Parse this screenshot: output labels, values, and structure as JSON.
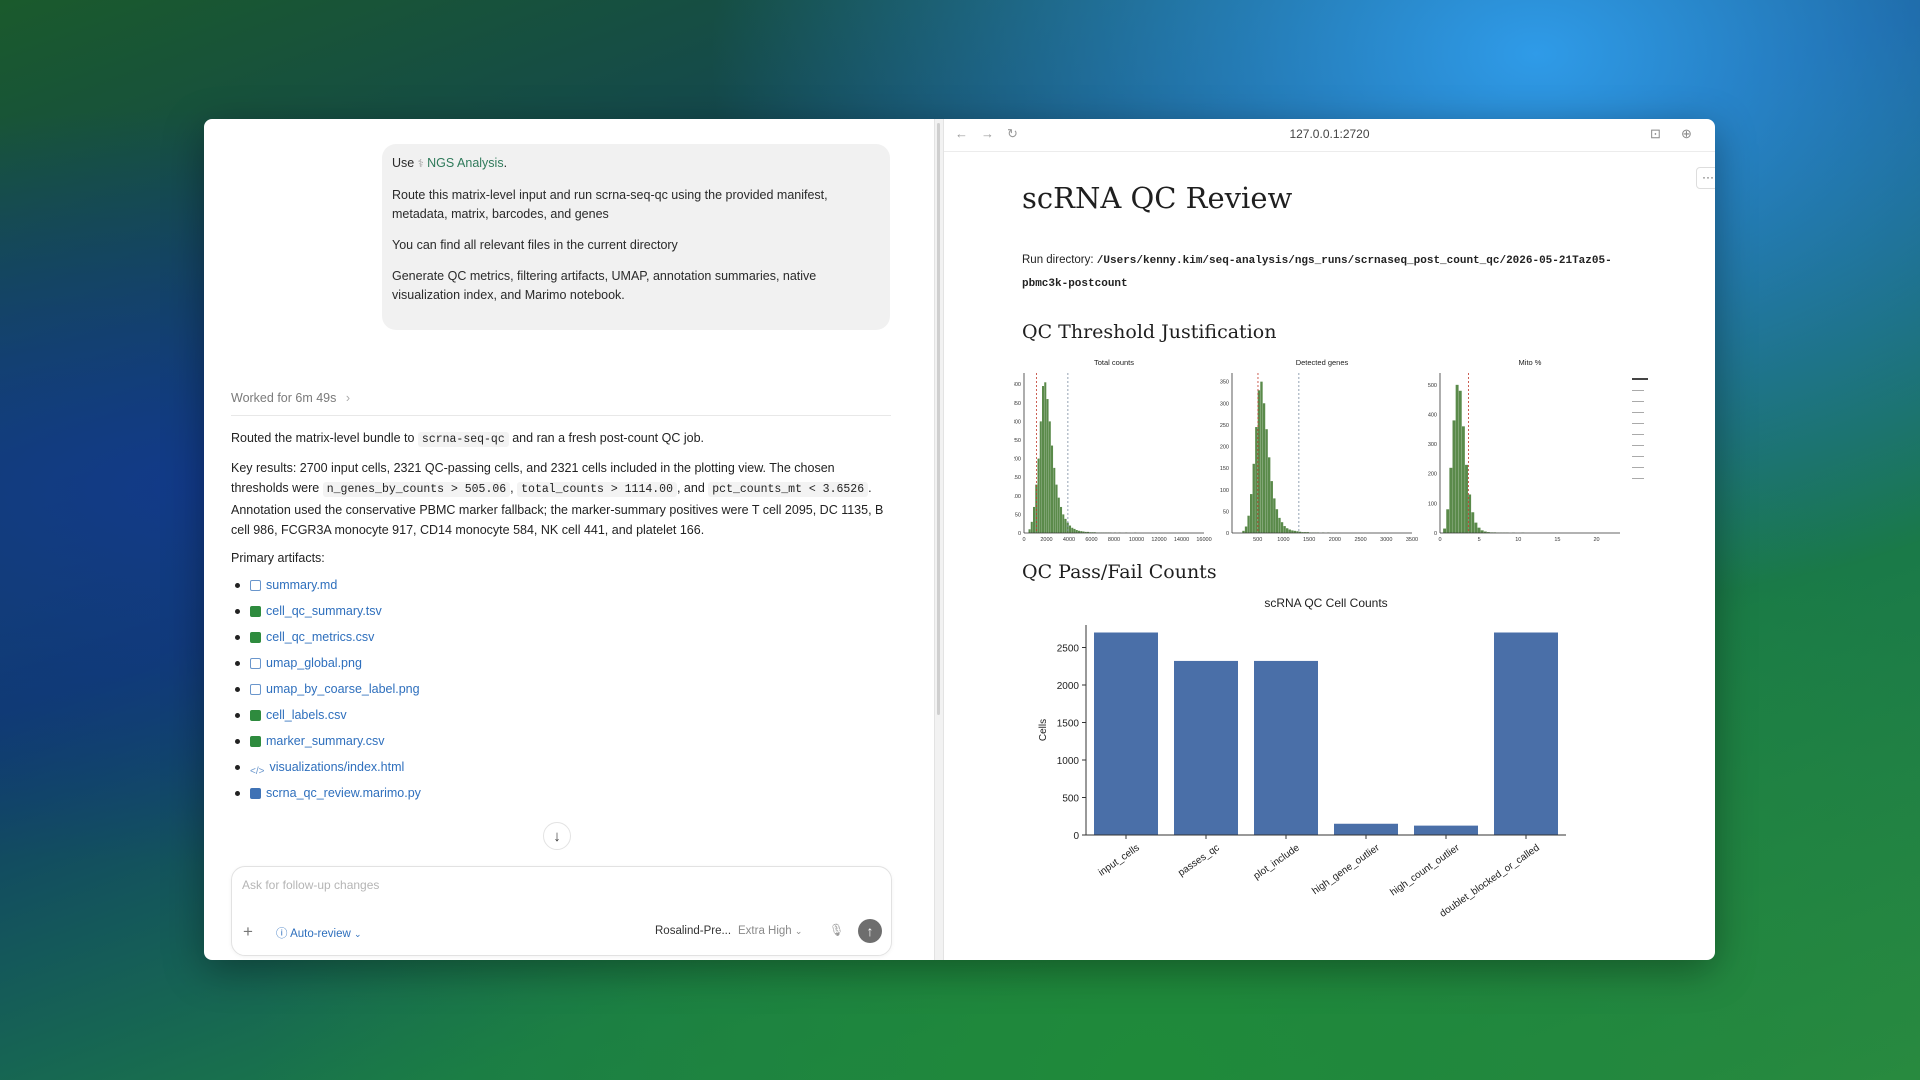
{
  "chat": {
    "user_message": {
      "use_prefix": "Use",
      "skill_name": "NGS Analysis",
      "skill_suffix": ".",
      "line1": "Route this matrix-level input and run scrna-seq-qc using the provided manifest, metadata, matrix, barcodes, and genes",
      "line2": "You can find all relevant files in the current directory",
      "line3": "Generate QC metrics, filtering artifacts, UMAP, annotation summaries, native visualization index, and Marimo notebook."
    },
    "worked_for": "Worked for 6m 49s",
    "answer": {
      "p1_a": "Routed the matrix-level bundle to",
      "p1_code": "scrna-seq-qc",
      "p1_b": "and ran a fresh post-count QC job.",
      "p2_a": "Key results: 2700 input cells, 2321 QC-passing cells, and 2321 cells included in the plotting view. The chosen thresholds were",
      "p2_code1": "n_genes_by_counts > 505.06",
      "p2_sep1": ",",
      "p2_code2": "total_counts > 1114.00",
      "p2_sep2": ", and",
      "p2_code3": "pct_counts_mt < 3.6526",
      "p2_b": ". Annotation used the conservative PBMC marker fallback; the marker-summary positives were T cell 2095, DC 1135, B cell 986, FCGR3A monocyte 917, CD14 monocyte 584, NK cell 441, and platelet 166.",
      "primary_label": "Primary artifacts:",
      "artifacts": [
        {
          "name": "summary.md",
          "icon": "markdown-file-icon"
        },
        {
          "name": "cell_qc_summary.tsv",
          "icon": "spreadsheet-file-icon"
        },
        {
          "name": "cell_qc_metrics.csv",
          "icon": "spreadsheet-file-icon"
        },
        {
          "name": "umap_global.png",
          "icon": "image-file-icon"
        },
        {
          "name": "umap_by_coarse_label.png",
          "icon": "image-file-icon"
        },
        {
          "name": "cell_labels.csv",
          "icon": "spreadsheet-file-icon"
        },
        {
          "name": "marker_summary.csv",
          "icon": "spreadsheet-file-icon"
        },
        {
          "name": "visualizations/index.html",
          "icon": "code-file-icon"
        },
        {
          "name": "scrna_qc_review.marimo.py",
          "icon": "python-file-icon"
        }
      ]
    },
    "composer": {
      "placeholder": "Ask for follow-up changes",
      "auto_review": "Auto-review",
      "model": "Rosalind-Pre...",
      "effort": "Extra High"
    }
  },
  "browser": {
    "url": "127.0.0.1:2720",
    "page": {
      "title": "scRNA QC Review",
      "run_dir_label": "Run directory:",
      "run_dir_path": "/Users/kenny.kim/seq-analysis/ngs_runs/scrnaseq_post_count_qc/2026-05-21Taz05-pbmc3k-postcount",
      "section1": "QC Threshold Justification",
      "section2": "QC Pass/Fail Counts"
    }
  },
  "chart_data": [
    {
      "type": "bar",
      "title": "Total counts",
      "xlabel": "",
      "ylabel": "",
      "xlim": [
        0,
        16000
      ],
      "x_ticks": [
        0,
        2000,
        4000,
        6000,
        8000,
        10000,
        12000,
        14000,
        16000
      ],
      "y_ticks": [
        0,
        50,
        100,
        150,
        200,
        250,
        300,
        350,
        400
      ],
      "ylim": [
        0,
        430
      ],
      "bin_width": 200,
      "bin_start": 400,
      "values": [
        10,
        30,
        70,
        130,
        200,
        300,
        395,
        405,
        360,
        300,
        235,
        175,
        130,
        95,
        70,
        50,
        38,
        28,
        20,
        14,
        11,
        8,
        6,
        5,
        4,
        3,
        3,
        2,
        2,
        2,
        1,
        1,
        1,
        1,
        1,
        1,
        1,
        0,
        1,
        0,
        1,
        0,
        0,
        1,
        0,
        0,
        0,
        1
      ],
      "threshold_lines": [
        1114,
        3900
      ],
      "color": "#5a8a4a"
    },
    {
      "type": "bar",
      "title": "Detected genes",
      "xlabel": "",
      "ylabel": "",
      "xlim": [
        0,
        3500
      ],
      "x_ticks": [
        500,
        1000,
        1500,
        2000,
        2500,
        3000,
        3500
      ],
      "y_ticks": [
        0,
        50,
        100,
        150,
        200,
        250,
        300,
        350
      ],
      "ylim": [
        0,
        370
      ],
      "bin_width": 50,
      "bin_start": 200,
      "values": [
        5,
        15,
        40,
        90,
        160,
        245,
        330,
        350,
        300,
        240,
        175,
        120,
        80,
        55,
        35,
        25,
        16,
        11,
        8,
        6,
        5,
        4,
        3,
        2,
        2,
        2,
        1,
        1,
        1,
        1,
        0,
        1,
        0,
        1
      ],
      "threshold_lines": [
        505,
        1300
      ],
      "color": "#5a8a4a"
    },
    {
      "type": "bar",
      "title": "Mito %",
      "xlabel": "",
      "ylabel": "",
      "xlim": [
        0,
        23
      ],
      "x_ticks": [
        0,
        5,
        10,
        15,
        20
      ],
      "y_ticks": [
        0,
        100,
        200,
        300,
        400,
        500
      ],
      "ylim": [
        0,
        540
      ],
      "bin_width": 0.4,
      "bin_start": 0.4,
      "values": [
        15,
        80,
        220,
        380,
        500,
        480,
        360,
        230,
        130,
        70,
        35,
        18,
        9,
        5,
        3,
        2,
        2,
        1,
        1,
        1,
        1,
        0,
        1,
        0,
        0,
        1
      ],
      "threshold_lines": [
        3.65
      ],
      "color": "#5a8a4a"
    },
    {
      "type": "bar",
      "title": "scRNA QC Cell Counts",
      "xlabel": "",
      "ylabel": "Cells",
      "categories": [
        "input_cells",
        "passes_qc",
        "plot_include",
        "high_gene_outlier",
        "high_count_outlier",
        "doublet_blocked_or_called"
      ],
      "values": [
        2700,
        2321,
        2321,
        150,
        125,
        2700
      ],
      "y_ticks": [
        0,
        500,
        1000,
        1500,
        2000,
        2500
      ],
      "ylim": [
        0,
        2800
      ],
      "color": "#4a6fa8"
    }
  ]
}
